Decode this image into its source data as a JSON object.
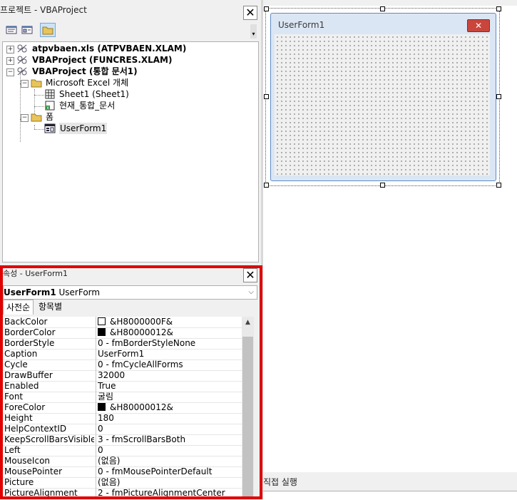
{
  "project": {
    "title": "프로젝트 - VBAProject",
    "close": "✕",
    "toolbar": [
      "view-code-icon",
      "view-object-icon",
      "toggle-folders-icon"
    ],
    "tree": [
      {
        "label": "atpvbaen.xls (ATPVBAEN.XLAM)",
        "bold": true,
        "icon": "vba-project-icon",
        "expander": "+"
      },
      {
        "label": "VBAProject (FUNCRES.XLAM)",
        "bold": true,
        "icon": "vba-project-icon",
        "expander": "+"
      },
      {
        "label": "VBAProject (통합 문서1)",
        "bold": true,
        "icon": "vba-project-icon",
        "expander": "−"
      },
      {
        "label": "Microsoft Excel 개체",
        "bold": false,
        "icon": "folder-icon",
        "expander": "−"
      },
      {
        "label": "Sheet1 (Sheet1)",
        "bold": false,
        "icon": "sheet-icon"
      },
      {
        "label": "현재_통합_문서",
        "bold": false,
        "icon": "workbook-icon"
      },
      {
        "label": "폼",
        "bold": false,
        "icon": "folder-icon",
        "expander": "−"
      },
      {
        "label": "UserForm1",
        "bold": false,
        "icon": "userform-icon"
      }
    ]
  },
  "properties": {
    "title": "속성 - UserForm1",
    "close": "✕",
    "object_name": "UserForm1",
    "object_type": "UserForm",
    "tabs": [
      "사전순",
      "항목별"
    ],
    "rows": [
      {
        "name": "BackColor",
        "value": "&H8000000F&",
        "swatch": "#ffffff"
      },
      {
        "name": "BorderColor",
        "value": "&H80000012&",
        "swatch": "#000000"
      },
      {
        "name": "BorderStyle",
        "value": "0 - fmBorderStyleNone"
      },
      {
        "name": "Caption",
        "value": "UserForm1"
      },
      {
        "name": "Cycle",
        "value": "0 - fmCycleAllForms"
      },
      {
        "name": "DrawBuffer",
        "value": "32000"
      },
      {
        "name": "Enabled",
        "value": "True"
      },
      {
        "name": "Font",
        "value": "굴림"
      },
      {
        "name": "ForeColor",
        "value": "&H80000012&",
        "swatch": "#000000"
      },
      {
        "name": "Height",
        "value": "180"
      },
      {
        "name": "HelpContextID",
        "value": "0"
      },
      {
        "name": "KeepScrollBarsVisible",
        "value": "3 - fmScrollBarsBoth"
      },
      {
        "name": "Left",
        "value": "0"
      },
      {
        "name": "MouseIcon",
        "value": "(없음)"
      },
      {
        "name": "MousePointer",
        "value": "0 - fmMousePointerDefault"
      },
      {
        "name": "Picture",
        "value": "(없음)"
      },
      {
        "name": "PictureAlignment",
        "value": "2 - fmPictureAlignmentCenter"
      }
    ]
  },
  "designer": {
    "form_caption": "UserForm1",
    "form_close": "✕"
  },
  "immediate": {
    "title": "직접 실행"
  },
  "colors": {
    "highlight": "#e00000",
    "form_border": "#5e8ac6",
    "close_red": "#c9463d"
  }
}
